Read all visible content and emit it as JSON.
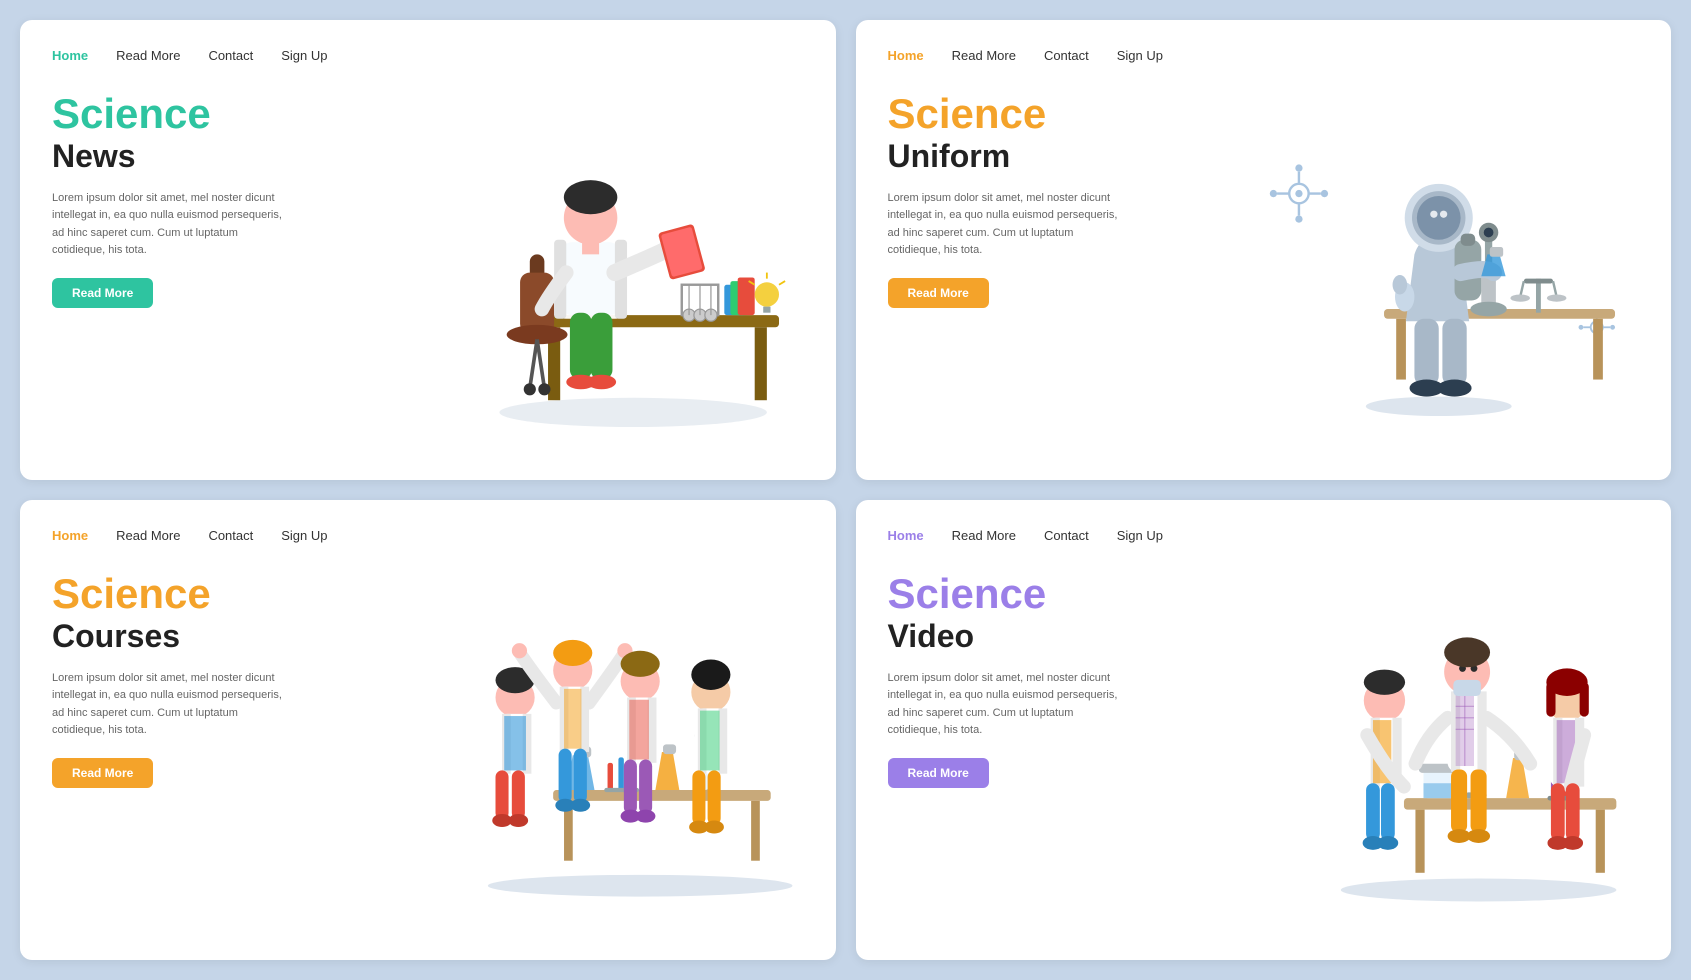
{
  "cards": [
    {
      "id": "science-news",
      "nav": [
        {
          "label": "Home",
          "active": true,
          "theme": "green"
        },
        {
          "label": "Read More",
          "active": false
        },
        {
          "label": "Contact",
          "active": false
        },
        {
          "label": "Sign Up",
          "active": false
        }
      ],
      "title_colored": "Science",
      "title_plain": "News",
      "theme": "green",
      "description": "Lorem ipsum dolor sit amet, mel noster dicunt intellegat in, ea quo nulla euismod persequeris, ad hinc saperet cum. Cum ut luptatum cotidieque, his tota.",
      "btn_label": "Read More",
      "accent": "#2ec4a0"
    },
    {
      "id": "science-uniform",
      "nav": [
        {
          "label": "Home",
          "active": true,
          "theme": "orange"
        },
        {
          "label": "Read More",
          "active": false
        },
        {
          "label": "Contact",
          "active": false
        },
        {
          "label": "Sign Up",
          "active": false
        }
      ],
      "title_colored": "Science",
      "title_plain": "Uniform",
      "theme": "orange",
      "description": "Lorem ipsum dolor sit amet, mel noster dicunt intellegat in, ea quo nulla euismod persequeris, ad hinc saperet cum. Cum ut luptatum cotidieque, his tota.",
      "btn_label": "Read More",
      "accent": "#f4a32a"
    },
    {
      "id": "science-courses",
      "nav": [
        {
          "label": "Home",
          "active": true,
          "theme": "orange"
        },
        {
          "label": "Read More",
          "active": false
        },
        {
          "label": "Contact",
          "active": false
        },
        {
          "label": "Sign Up",
          "active": false
        }
      ],
      "title_colored": "Science",
      "title_plain": "Courses",
      "theme": "orange",
      "description": "Lorem ipsum dolor sit amet, mel noster dicunt intellegat in, ea quo nulla euismod persequeris, ad hinc saperet cum. Cum ut luptatum cotidieque, his tota.",
      "btn_label": "Read More",
      "accent": "#f4a32a"
    },
    {
      "id": "science-video",
      "nav": [
        {
          "label": "Home",
          "active": true,
          "theme": "purple"
        },
        {
          "label": "Read More",
          "active": false
        },
        {
          "label": "Contact",
          "active": false
        },
        {
          "label": "Sign Up",
          "active": false
        }
      ],
      "title_colored": "Science",
      "title_plain": "Video",
      "theme": "purple",
      "description": "Lorem ipsum dolor sit amet, mel noster dicunt intellegat in, ea quo nulla euismod persequeris, ad hinc saperet cum. Cum ut luptatum cotidieque, his tota.",
      "btn_label": "Read More",
      "accent": "#9b7fe8"
    }
  ]
}
